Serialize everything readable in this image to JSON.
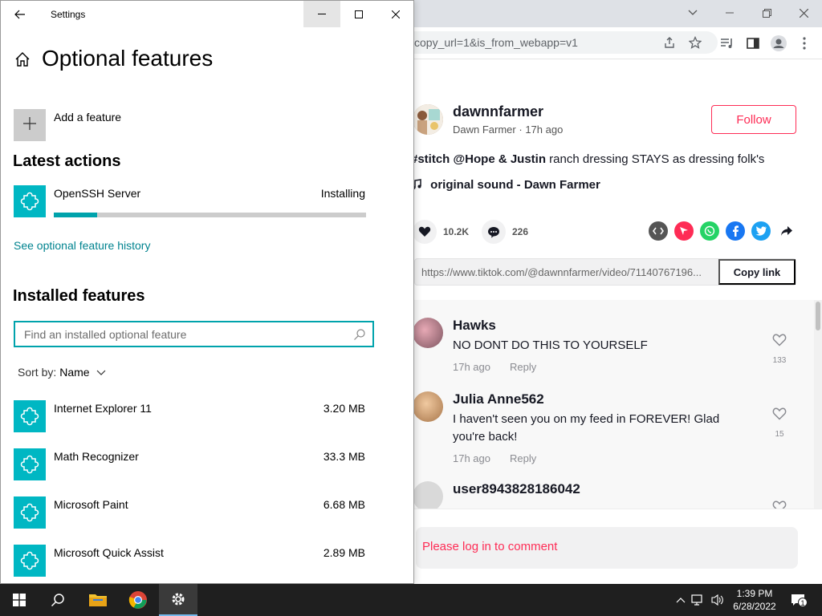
{
  "browser": {
    "url_fragment": "copy_url=1&is_from_webapp=v1",
    "post": {
      "username": "dawnnfarmer",
      "display_name": "Dawn Farmer",
      "time": "17h ago",
      "follow_label": "Follow",
      "caption_tag": "#stitch",
      "caption_mention": "@Hope & Justin",
      "caption_text": "ranch dressing STAYS as dressing folk's",
      "sound": "original sound - Dawn Farmer",
      "likes": "10.2K",
      "comments_count": "226",
      "link": "https://www.tiktok.com/@dawnnfarmer/video/71140767196...",
      "copy_link_label": "Copy link"
    },
    "comments": [
      {
        "name": "Hawks",
        "text": "NO DONT DO THIS TO YOURSELF",
        "time": "17h ago",
        "reply": "Reply",
        "likes": "133"
      },
      {
        "name": "Julia Anne562",
        "text": "I haven't seen you on my feed in FOREVER! Glad you're back!",
        "time": "17h ago",
        "reply": "Reply",
        "likes": "15"
      },
      {
        "name": "user8943828186042"
      }
    ],
    "login_prompt": "Please log in to comment"
  },
  "settings": {
    "app_title": "Settings",
    "page_title": "Optional features",
    "add_feature_label": "Add a feature",
    "latest_actions_heading": "Latest actions",
    "action": {
      "name": "OpenSSH Server",
      "status": "Installing",
      "progress": 0.14
    },
    "history_link": "See optional feature history",
    "installed_heading": "Installed features",
    "search_placeholder": "Find an installed optional feature",
    "sort_label": "Sort by:",
    "sort_value": "Name",
    "features": [
      {
        "name": "Internet Explorer 11",
        "size": "3.20 MB"
      },
      {
        "name": "Math Recognizer",
        "size": "33.3 MB"
      },
      {
        "name": "Microsoft Paint",
        "size": "6.68 MB"
      },
      {
        "name": "Microsoft Quick Assist",
        "size": "2.89 MB"
      }
    ]
  },
  "taskbar": {
    "time": "1:39 PM",
    "date": "6/28/2022",
    "notification_count": "1"
  },
  "colors": {
    "accent": "#00b7c3",
    "tiktok_red": "#fe2c55"
  }
}
